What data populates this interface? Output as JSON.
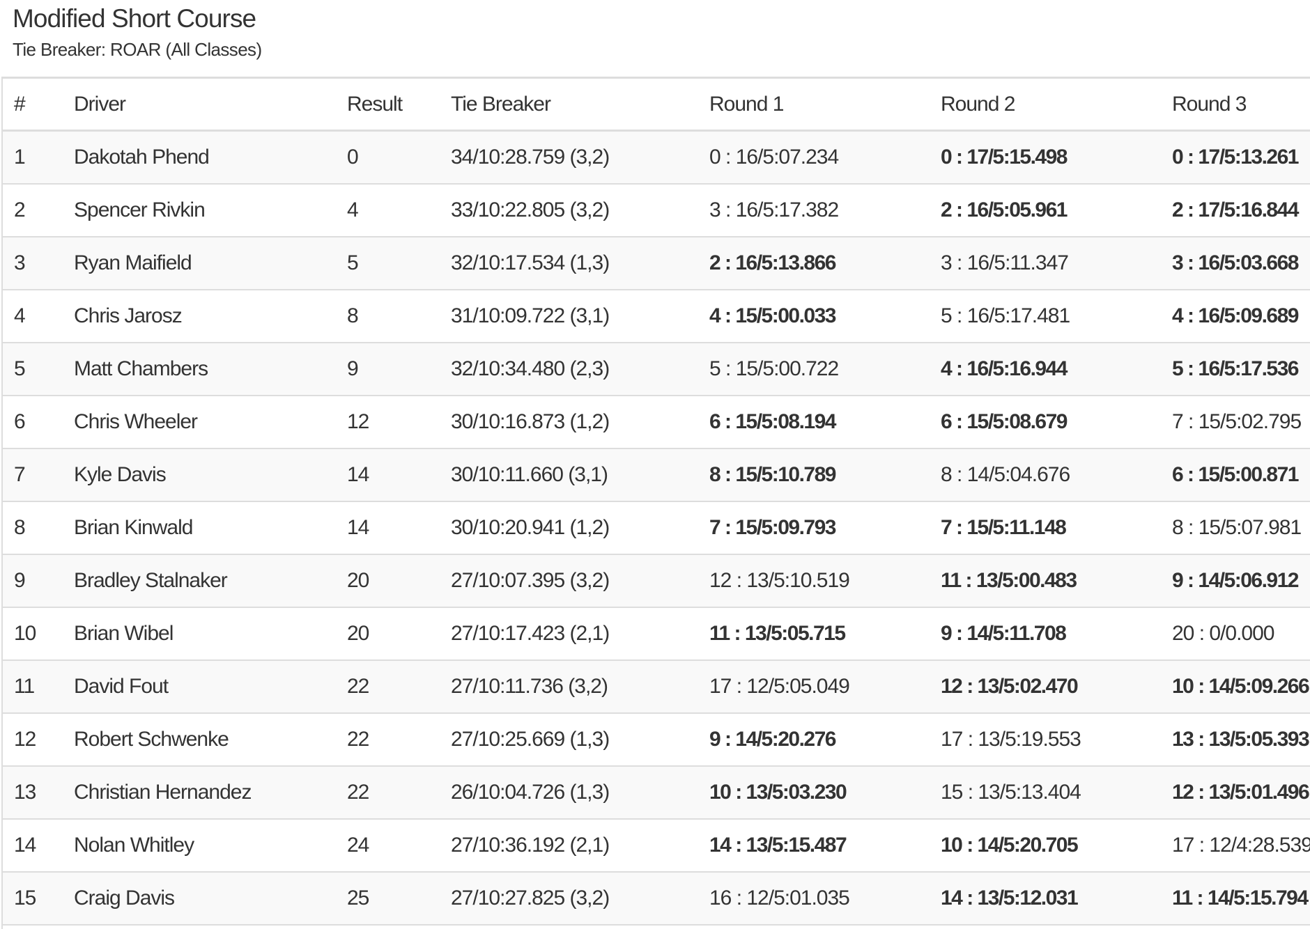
{
  "page": {
    "title": "Modified Short Course",
    "subtitle": "Tie Breaker: ROAR (All Classes)"
  },
  "table": {
    "columns": [
      "#",
      "Driver",
      "Result",
      "Tie Breaker",
      "Round 1",
      "Round 2",
      "Round 3"
    ],
    "rows": [
      {
        "pos": "1",
        "driver": "Dakotah Phend",
        "result": "0",
        "tie_breaker": "34/10:28.759 (3,2)",
        "round1": "0 : 16/5:07.234",
        "round1_bold": false,
        "round2": "0 : 17/5:15.498",
        "round2_bold": true,
        "round3": "0 : 17/5:13.261",
        "round3_bold": true
      },
      {
        "pos": "2",
        "driver": "Spencer Rivkin",
        "result": "4",
        "tie_breaker": "33/10:22.805 (3,2)",
        "round1": "3 : 16/5:17.382",
        "round1_bold": false,
        "round2": "2 : 16/5:05.961",
        "round2_bold": true,
        "round3": "2 : 17/5:16.844",
        "round3_bold": true
      },
      {
        "pos": "3",
        "driver": "Ryan Maifield",
        "result": "5",
        "tie_breaker": "32/10:17.534 (1,3)",
        "round1": "2 : 16/5:13.866",
        "round1_bold": true,
        "round2": "3 : 16/5:11.347",
        "round2_bold": false,
        "round3": "3 : 16/5:03.668",
        "round3_bold": true
      },
      {
        "pos": "4",
        "driver": "Chris Jarosz",
        "result": "8",
        "tie_breaker": "31/10:09.722 (3,1)",
        "round1": "4 : 15/5:00.033",
        "round1_bold": true,
        "round2": "5 : 16/5:17.481",
        "round2_bold": false,
        "round3": "4 : 16/5:09.689",
        "round3_bold": true
      },
      {
        "pos": "5",
        "driver": "Matt Chambers",
        "result": "9",
        "tie_breaker": "32/10:34.480 (2,3)",
        "round1": "5 : 15/5:00.722",
        "round1_bold": false,
        "round2": "4 : 16/5:16.944",
        "round2_bold": true,
        "round3": "5 : 16/5:17.536",
        "round3_bold": true
      },
      {
        "pos": "6",
        "driver": "Chris Wheeler",
        "result": "12",
        "tie_breaker": "30/10:16.873 (1,2)",
        "round1": "6 : 15/5:08.194",
        "round1_bold": true,
        "round2": "6 : 15/5:08.679",
        "round2_bold": true,
        "round3": "7 : 15/5:02.795",
        "round3_bold": false
      },
      {
        "pos": "7",
        "driver": "Kyle Davis",
        "result": "14",
        "tie_breaker": "30/10:11.660 (3,1)",
        "round1": "8 : 15/5:10.789",
        "round1_bold": true,
        "round2": "8 : 14/5:04.676",
        "round2_bold": false,
        "round3": "6 : 15/5:00.871",
        "round3_bold": true
      },
      {
        "pos": "8",
        "driver": "Brian Kinwald",
        "result": "14",
        "tie_breaker": "30/10:20.941 (1,2)",
        "round1": "7 : 15/5:09.793",
        "round1_bold": true,
        "round2": "7 : 15/5:11.148",
        "round2_bold": true,
        "round3": "8 : 15/5:07.981",
        "round3_bold": false
      },
      {
        "pos": "9",
        "driver": "Bradley Stalnaker",
        "result": "20",
        "tie_breaker": "27/10:07.395 (3,2)",
        "round1": "12 : 13/5:10.519",
        "round1_bold": false,
        "round2": "11 : 13/5:00.483",
        "round2_bold": true,
        "round3": "9 : 14/5:06.912",
        "round3_bold": true
      },
      {
        "pos": "10",
        "driver": "Brian Wibel",
        "result": "20",
        "tie_breaker": "27/10:17.423 (2,1)",
        "round1": "11 : 13/5:05.715",
        "round1_bold": true,
        "round2": "9 : 14/5:11.708",
        "round2_bold": true,
        "round3": "20 : 0/0.000",
        "round3_bold": false
      },
      {
        "pos": "11",
        "driver": "David Fout",
        "result": "22",
        "tie_breaker": "27/10:11.736 (3,2)",
        "round1": "17 : 12/5:05.049",
        "round1_bold": false,
        "round2": "12 : 13/5:02.470",
        "round2_bold": true,
        "round3": "10 : 14/5:09.266",
        "round3_bold": true
      },
      {
        "pos": "12",
        "driver": "Robert Schwenke",
        "result": "22",
        "tie_breaker": "27/10:25.669 (1,3)",
        "round1": "9 : 14/5:20.276",
        "round1_bold": true,
        "round2": "17 : 13/5:19.553",
        "round2_bold": false,
        "round3": "13 : 13/5:05.393",
        "round3_bold": true
      },
      {
        "pos": "13",
        "driver": "Christian Hernandez",
        "result": "22",
        "tie_breaker": "26/10:04.726 (1,3)",
        "round1": "10 : 13/5:03.230",
        "round1_bold": true,
        "round2": "15 : 13/5:13.404",
        "round2_bold": false,
        "round3": "12 : 13/5:01.496",
        "round3_bold": true
      },
      {
        "pos": "14",
        "driver": "Nolan Whitley",
        "result": "24",
        "tie_breaker": "27/10:36.192 (2,1)",
        "round1": "14 : 13/5:15.487",
        "round1_bold": true,
        "round2": "10 : 14/5:20.705",
        "round2_bold": true,
        "round3": "17 : 12/4:28.539",
        "round3_bold": false
      },
      {
        "pos": "15",
        "driver": "Craig Davis",
        "result": "25",
        "tie_breaker": "27/10:27.825 (3,2)",
        "round1": "16 : 12/5:01.035",
        "round1_bold": false,
        "round2": "14 : 13/5:12.031",
        "round2_bold": true,
        "round3": "11 : 14/5:15.794",
        "round3_bold": true
      }
    ]
  }
}
